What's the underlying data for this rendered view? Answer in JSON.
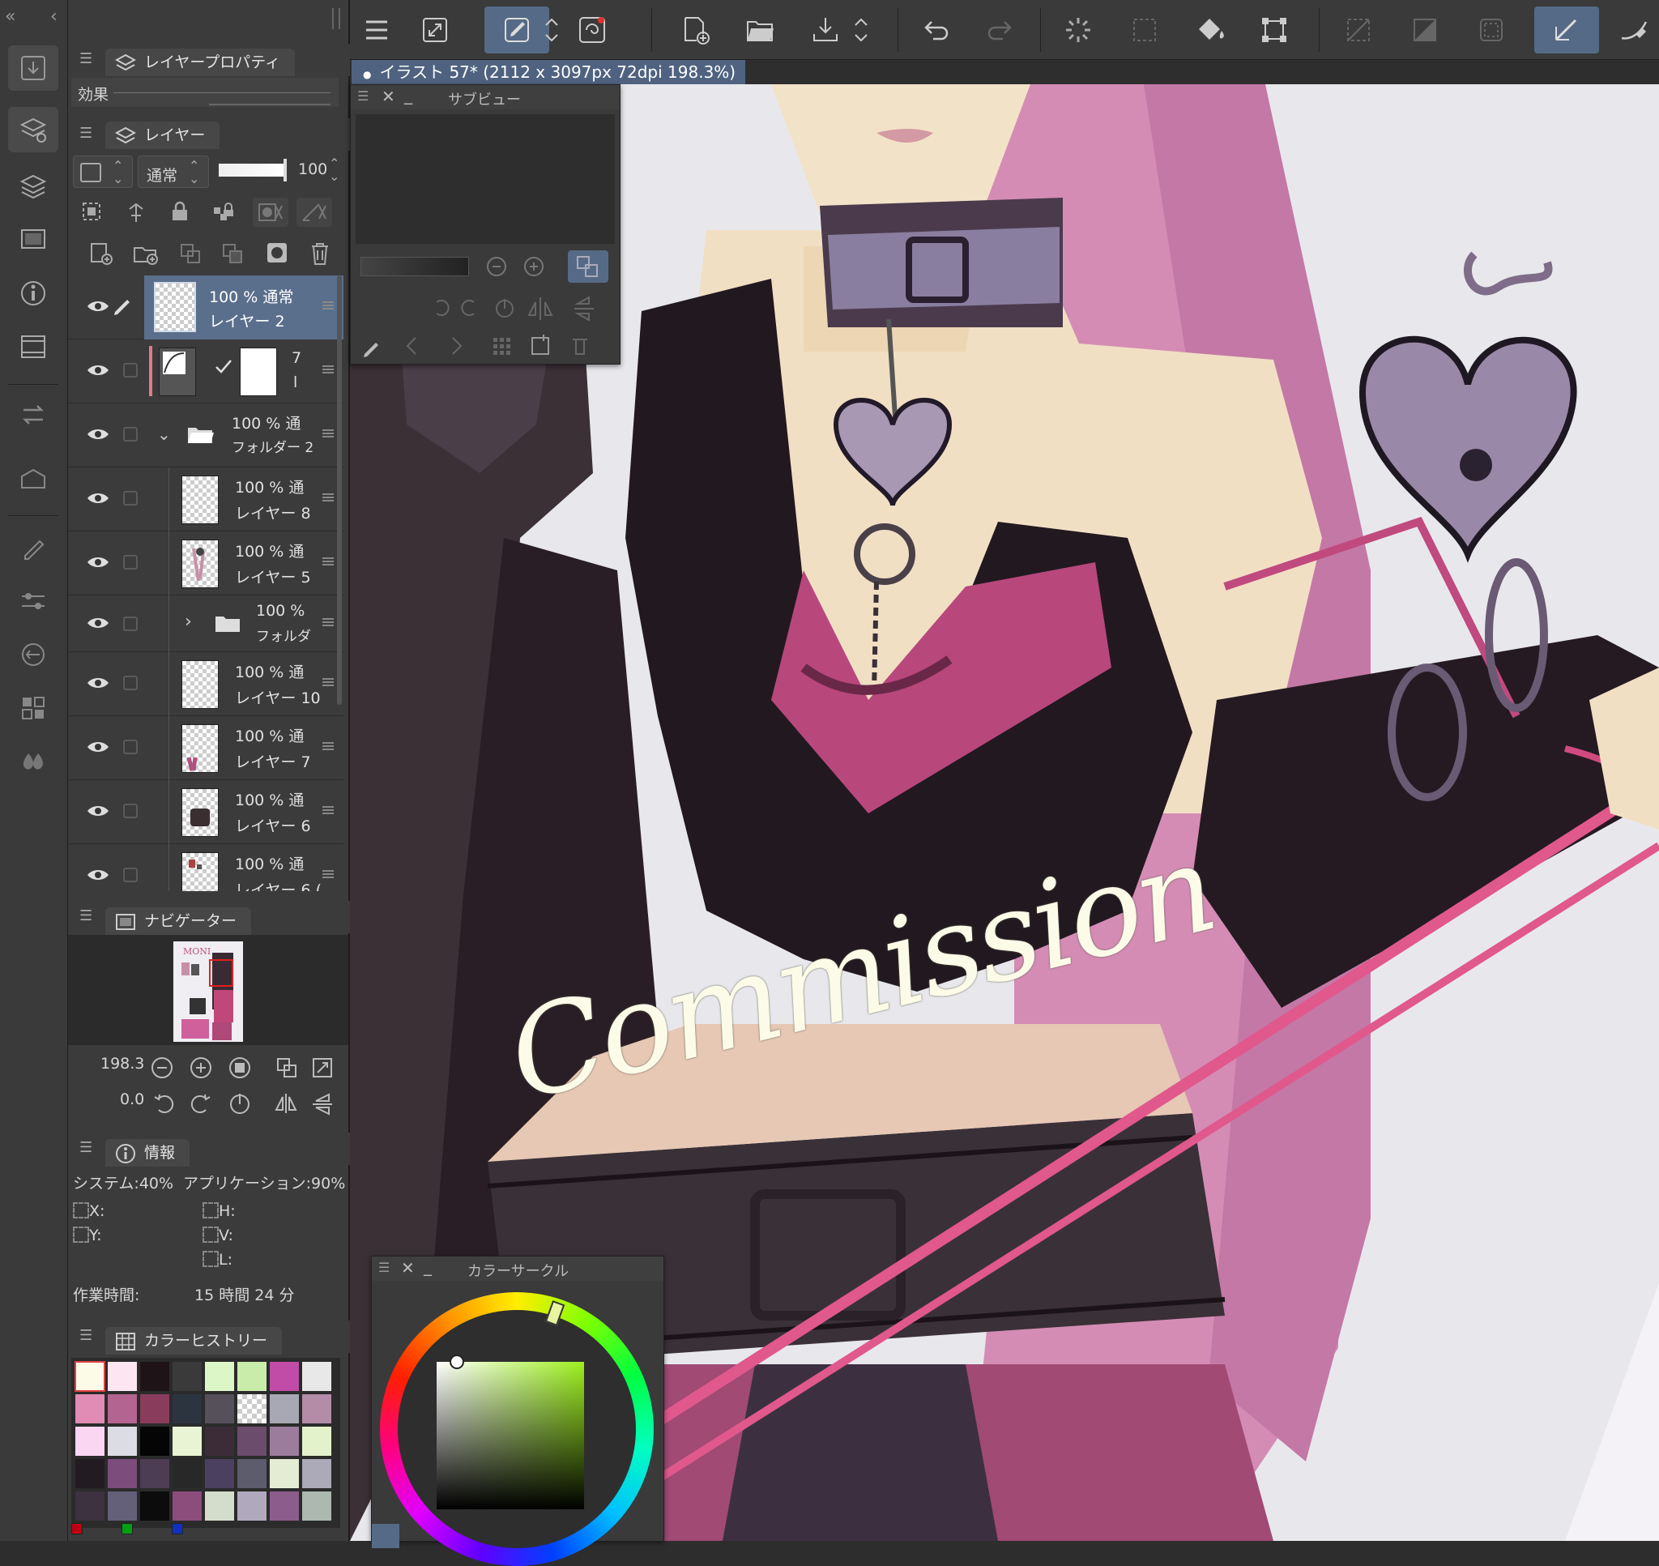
{
  "document": {
    "tab_title": "イラスト 57* (2112 x 3097px 72dpi 198.3%)"
  },
  "panels": {
    "layer_property": {
      "title": "レイヤープロパティ",
      "effect_label": "効果"
    },
    "layers": {
      "title": "レイヤー",
      "blend_mode": "通常",
      "opacity": "100",
      "rows": [
        {
          "line1": "100 %  通常",
          "line2": "レイヤー 2",
          "selected": true
        },
        {
          "line1": "7",
          "line2": "l",
          "type": "mask"
        },
        {
          "line1": "100 %  通",
          "line2": "フォルダー 2",
          "type": "folder-open"
        },
        {
          "line1": "100 %  通",
          "line2": "レイヤー 8"
        },
        {
          "line1": "100 %  通",
          "line2": "レイヤー 5"
        },
        {
          "line1": "100 %",
          "line2": "フォルダ",
          "type": "folder-closed"
        },
        {
          "line1": "100 %  通",
          "line2": "レイヤー 10"
        },
        {
          "line1": "100 %  通",
          "line2": "レイヤー 7"
        },
        {
          "line1": "100 %  通",
          "line2": "レイヤー 6"
        },
        {
          "line1": "100 %  通",
          "line2": "レイヤー 6 (",
          "partial": true
        }
      ]
    },
    "navigator": {
      "title": "ナビゲーター",
      "zoom": "198.3",
      "rotation": "0.0"
    },
    "info": {
      "title": "情報",
      "system": "システム:40%",
      "application": "アプリケーション:90%",
      "x_label": "X:",
      "y_label": "Y:",
      "h_label": "H:",
      "v_label": "V:",
      "l_label": "L:",
      "work_time_label": "作業時間:",
      "work_time_value": "15 時間 24 分"
    },
    "color_history": {
      "title": "カラーヒストリー",
      "colors": [
        "#fbfbe8",
        "#fde6f2",
        "#1e1418",
        "#3a3a3a",
        "#ddf6c8",
        "#c9ecaa",
        "#c04ca8",
        "#e8e8e8",
        "#e08cb4",
        "#b46490",
        "#8a3c5c",
        "#2c3440",
        "#55505a",
        "checker",
        "#a8a8b4",
        "#b48ca8",
        "#fbd6f2",
        "#dcdce4",
        "#050505",
        "#e8f4d4",
        "#3c2c38",
        "#6c4c6c",
        "#9c7c9c",
        "#e4f2cc",
        "#221c22",
        "#7c4c7c",
        "#4c3c54",
        "#282828",
        "#4c4060",
        "#5c5c6c",
        "#e4ecd4",
        "#acaab8",
        "#3c3240",
        "#64607a",
        "#0c0c0c",
        "#8c4c7c",
        "#d4dccc",
        "#b0a8bc",
        "#8c5c8c",
        "#acb8b0"
      ]
    }
  },
  "subview": {
    "title": "サブビュー"
  },
  "color_circle": {
    "title": "カラーサークル",
    "hue_color": "#9ef01e"
  },
  "canvas": {
    "watermark": "Commission"
  },
  "colors": {
    "accent": "#556a86",
    "selected_layer": "#5a6f8c",
    "panel_bg": "#3b3b3b"
  }
}
